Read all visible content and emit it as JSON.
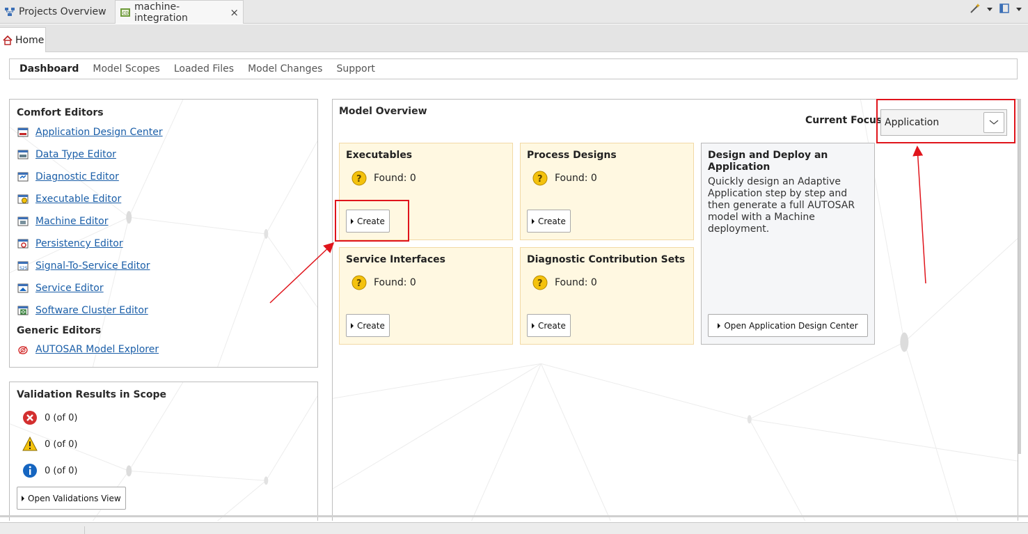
{
  "tabs": [
    {
      "label": "Projects Overview",
      "icon": "projects-overview-icon"
    },
    {
      "label": "machine-integration",
      "icon": "editor-file-icon",
      "close": "×"
    }
  ],
  "home_tab": {
    "label": "Home",
    "icon": "home-icon"
  },
  "nav": {
    "items": [
      "Dashboard",
      "Model Scopes",
      "Loaded Files",
      "Model Changes",
      "Support"
    ],
    "active": "Dashboard"
  },
  "comfort_editors": {
    "title": "Comfort Editors",
    "items": [
      {
        "label": "Application Design Center",
        "icon": "app-design-icon"
      },
      {
        "label": "Data Type Editor",
        "icon": "data-type-icon"
      },
      {
        "label": "Diagnostic Editor",
        "icon": "diagnostic-icon"
      },
      {
        "label": "Executable Editor",
        "icon": "executable-icon"
      },
      {
        "label": "Machine Editor",
        "icon": "machine-icon"
      },
      {
        "label": "Persistency Editor",
        "icon": "persistency-icon"
      },
      {
        "label": "Signal-To-Service Editor",
        "icon": "signal-to-service-icon"
      },
      {
        "label": "Service Editor",
        "icon": "service-icon"
      },
      {
        "label": "Software Cluster Editor",
        "icon": "software-cluster-icon"
      }
    ],
    "generic_title": "Generic Editors",
    "generic_items": [
      {
        "label": "AUTOSAR Model Explorer",
        "icon": "autosar-explorer-icon"
      }
    ]
  },
  "validation": {
    "title": "Validation Results in Scope",
    "rows": [
      {
        "icon": "error-icon",
        "text": "0 (of 0)",
        "color": "#d32f2f"
      },
      {
        "icon": "warning-icon",
        "text": "0 (of 0)",
        "color": "#f4c20d"
      },
      {
        "icon": "info-icon",
        "text": "0 (of 0)",
        "color": "#1565c0"
      }
    ],
    "button": "Open Validations View"
  },
  "overview": {
    "title": "Model Overview",
    "focus_label": "Current Focus:",
    "focus_value": "Application",
    "cards": [
      {
        "title": "Executables",
        "found": "Found: 0",
        "button": "Create"
      },
      {
        "title": "Process Designs",
        "found": "Found: 0",
        "button": "Create"
      },
      {
        "title": "Service Interfaces",
        "found": "Found: 0",
        "button": "Create"
      },
      {
        "title": "Diagnostic Contribution Sets",
        "found": "Found: 0",
        "button": "Create"
      }
    ],
    "deploy": {
      "title": "Design and Deploy an Application",
      "description": "Quickly design an Adaptive Application step by step and then generate a full AUTOSAR model with a Machine deployment.",
      "button": "Open Application Design Center"
    }
  },
  "colors": {
    "link": "#1a5ea8",
    "card_bg": "#fff8e1",
    "card_border": "#f2d9a5",
    "annotation_red": "#e0141b"
  }
}
